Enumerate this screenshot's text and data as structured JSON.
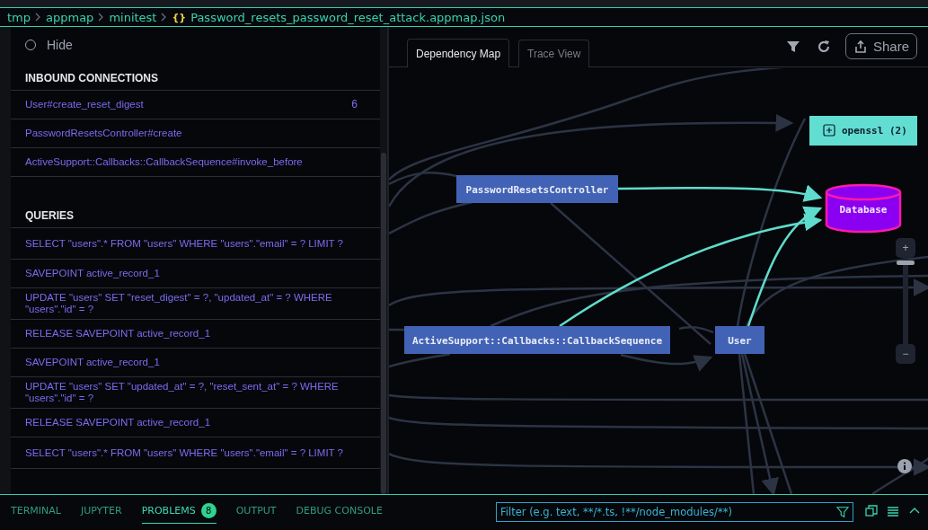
{
  "breadcrumb": {
    "segments": [
      "tmp",
      "appmap",
      "minitest"
    ],
    "file_icon": "{}",
    "file": "Password_resets_password_reset_attack.appmap.json"
  },
  "filter_panel": {
    "hide_option": {
      "label": "Hide",
      "checked": false
    }
  },
  "inbound_connections": {
    "title": "INBOUND CONNECTIONS",
    "items": [
      {
        "label": "User#create_reset_digest",
        "count": "6"
      },
      {
        "label": "PasswordResetsController#create"
      },
      {
        "label": "ActiveSupport::Callbacks::CallbackSequence#invoke_before"
      }
    ]
  },
  "queries": {
    "title": "QUERIES",
    "items": [
      "SELECT \"users\".* FROM \"users\" WHERE \"users\".\"email\" = ? LIMIT ?",
      "SAVEPOINT active_record_1",
      "UPDATE \"users\" SET \"reset_digest\" = ?, \"updated_at\" = ? WHERE \"users\".\"id\" = ?",
      "RELEASE SAVEPOINT active_record_1",
      "SAVEPOINT active_record_1",
      "UPDATE \"users\" SET \"updated_at\" = ?, \"reset_sent_at\" = ? WHERE \"users\".\"id\" = ?",
      "RELEASE SAVEPOINT active_record_1",
      "SELECT \"users\".* FROM \"users\" WHERE \"users\".\"email\" = ? LIMIT ?"
    ]
  },
  "view_tabs": [
    {
      "label": "Dependency Map",
      "selected": true
    },
    {
      "label": "Trace View",
      "selected": false
    }
  ],
  "toolbar": {
    "share": "Share"
  },
  "map": {
    "nodes": [
      {
        "kind": "class",
        "label": "PasswordResetsController"
      },
      {
        "kind": "package",
        "label": "openssl (2)"
      },
      {
        "kind": "database",
        "label": "Database"
      },
      {
        "kind": "class",
        "label": "ActiveSupport::Callbacks::CallbackSequence"
      },
      {
        "kind": "class",
        "label": "User"
      }
    ],
    "zoom": {
      "plus": "+",
      "minus": "−",
      "level": 0.05
    }
  },
  "bottom_panel": {
    "tabs": [
      {
        "label": "TERMINAL",
        "selected": false
      },
      {
        "label": "JUPYTER",
        "selected": false
      },
      {
        "label": "PROBLEMS",
        "selected": true,
        "badge": "8"
      },
      {
        "label": "OUTPUT",
        "selected": false
      },
      {
        "label": "DEBUG CONSOLE",
        "selected": false
      }
    ],
    "filter": {
      "placeholder": "Filter (e.g. text, **/*.ts, !**/node_modules/**)"
    }
  }
}
